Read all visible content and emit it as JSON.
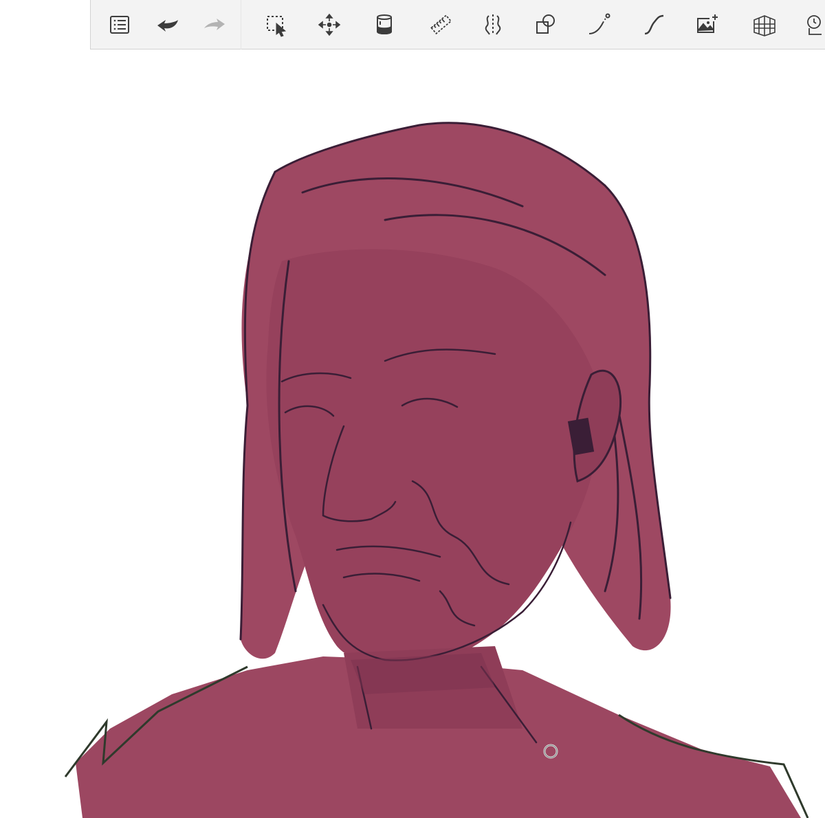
{
  "colors": {
    "toolbar_bg": "#f3f3f3",
    "icon": "#3c3c3c",
    "icon_disabled": "#b3b3b3",
    "canvas_bg": "#ffffff",
    "skin": "#9c4761",
    "lineart": "#3a1e36",
    "shadow": "#7e3350"
  },
  "toolbar": {
    "tools": [
      {
        "id": "layers",
        "icon": "list-icon",
        "enabled": true
      },
      {
        "id": "undo",
        "icon": "undo-arrow-icon",
        "enabled": true
      },
      {
        "id": "redo",
        "icon": "redo-arrow-icon",
        "enabled": false
      },
      {
        "id": "selection",
        "icon": "selection-cursor-icon",
        "enabled": true
      },
      {
        "id": "transform",
        "icon": "move-arrows-icon",
        "enabled": true
      },
      {
        "id": "fill",
        "icon": "paint-bucket-icon",
        "enabled": true
      },
      {
        "id": "ruler",
        "icon": "ruler-icon",
        "enabled": true
      },
      {
        "id": "symmetry",
        "icon": "symmetry-icon",
        "enabled": true
      },
      {
        "id": "shapes",
        "icon": "shapes-icon",
        "enabled": true
      },
      {
        "id": "stroke",
        "icon": "curve-line-icon",
        "enabled": true
      },
      {
        "id": "curve",
        "icon": "s-curve-icon",
        "enabled": true
      },
      {
        "id": "image",
        "icon": "add-image-icon",
        "enabled": true
      },
      {
        "id": "perspective",
        "icon": "perspective-grid-icon",
        "enabled": true
      },
      {
        "id": "time-lapse",
        "icon": "time-lapse-icon",
        "enabled": true
      }
    ]
  },
  "canvas": {
    "subject": "",
    "brush_cursor_icon": "brush-cursor-icon"
  }
}
